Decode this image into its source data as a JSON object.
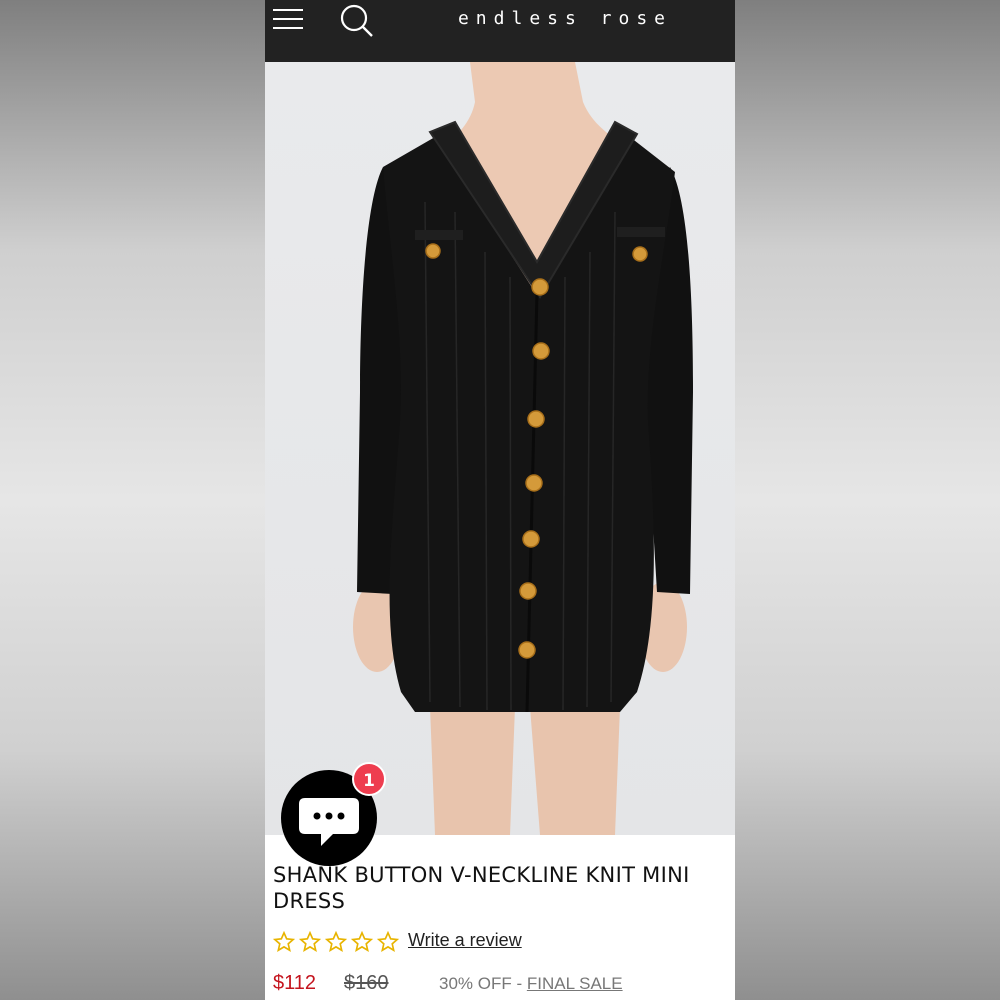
{
  "header": {
    "brand": "endless rose",
    "menu_icon": "hamburger-menu-icon",
    "search_icon": "search-icon"
  },
  "product": {
    "image_alt": "black knit mini dress with gold shank buttons",
    "title": "SHANK BUTTON V-NECKLINE KNIT MINI DRESS",
    "rating_stars": 0,
    "rating_max": 5,
    "review_link": "Write a review",
    "price": "$112",
    "compare_price": "$160",
    "discount_text": "30% OFF - ",
    "sale_label": "FINAL SALE"
  },
  "chat": {
    "icon": "chat-bubble-icon",
    "badge_count": "1"
  },
  "colors": {
    "header_bg": "#222222",
    "price_red": "#c4141e",
    "star_gold": "#e8b400",
    "badge_red": "#ee3d4f"
  }
}
